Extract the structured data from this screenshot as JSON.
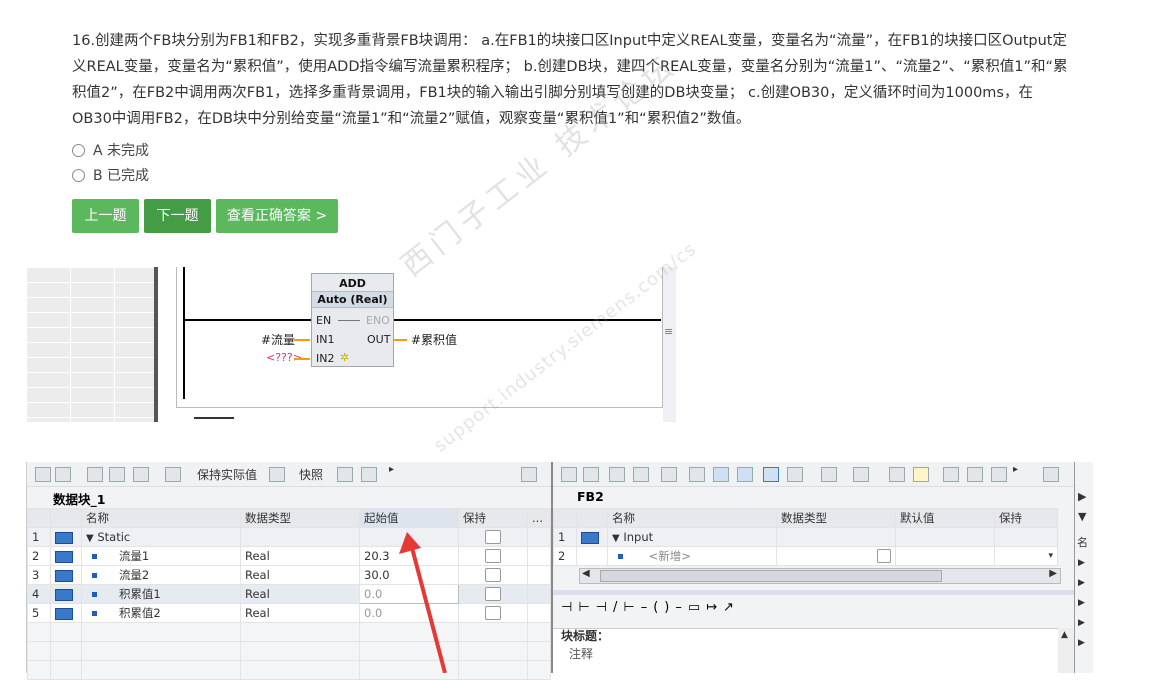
{
  "question": {
    "text": "16.创建两个FB块分别为FB1和FB2，实现多重背景FB块调用： a.在FB1的块接口区Input中定义REAL变量，变量名为“流量”，在FB1的块接口区Output定义REAL变量，变量名为“累积值”，使用ADD指令编写流量累积程序； b.创建DB块，建四个REAL变量，变量名分别为“流量1”、“流量2”、“累积值1”和“累积值2”，在FB2中调用两次FB1，选择多重背景调用，FB1块的输入输出引脚分别填写创建的DB块变量； c.创建OB30，定义循环时间为1000ms，在OB30中调用FB2，在DB块中分别给变量“流量1”和“流量2”赋值，观察变量“累积值1”和“累积值2”数值。"
  },
  "options": [
    {
      "label": "A  未完成"
    },
    {
      "label": "B  已完成"
    }
  ],
  "buttons": {
    "prev": "上一题",
    "next": "下一题",
    "answer": "查看正确答案 >"
  },
  "ladder": {
    "add_title": "ADD",
    "add_type": "Auto (Real)",
    "en": "EN",
    "eno": "ENO",
    "in1": "IN1",
    "in2": "IN2",
    "out": "OUT",
    "in1_var": "#流量",
    "in2_var": "<???>",
    "out_var": "#累积值"
  },
  "watermark": {
    "main": "西门子工业  技术论坛",
    "sub": "support.industry.siemens.com/cs"
  },
  "db": {
    "toolbar_keep": "保持实际值",
    "toolbar_snapshot": "快照",
    "title": "数据块_1",
    "headers": {
      "name": "名称",
      "type": "数据类型",
      "start": "起始值",
      "retain": "保持",
      "more": "..."
    },
    "rows": [
      {
        "no": "1",
        "name": "Static",
        "type": "",
        "start": ""
      },
      {
        "no": "2",
        "name": "流量1",
        "type": "Real",
        "start": "20.3"
      },
      {
        "no": "3",
        "name": "流量2",
        "type": "Real",
        "start": "30.0"
      },
      {
        "no": "4",
        "name": "积累值1",
        "type": "Real",
        "start": "0.0"
      },
      {
        "no": "5",
        "name": "积累值2",
        "type": "Real",
        "start": "0.0"
      }
    ]
  },
  "fb": {
    "title": "FB2",
    "headers": {
      "name": "名称",
      "type": "数据类型",
      "default": "默认值",
      "retain": "保持"
    },
    "rows": [
      {
        "no": "1",
        "name": "Input"
      },
      {
        "no": "2",
        "name": "<新增>"
      }
    ],
    "block_title": "块标题：",
    "comment": "注释",
    "side_label": "名"
  },
  "colors": {
    "green": "#5cb85c",
    "green_dark": "#449d44",
    "arrow": "#e53935",
    "wire": "#f39c12"
  }
}
